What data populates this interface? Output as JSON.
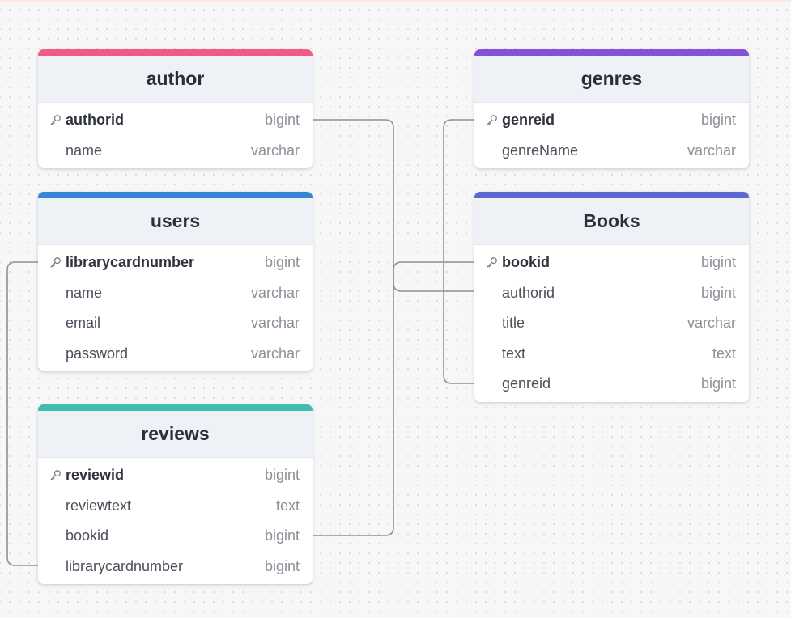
{
  "colors": {
    "author": "#ef5a86",
    "users": "#3584d6",
    "reviews": "#3dbfae",
    "genres": "#8452d6",
    "books": "#5a68cf",
    "link": "#8d9198"
  },
  "tables": {
    "author": {
      "title": "author",
      "columns": [
        {
          "name": "authorid",
          "type": "bigint",
          "pk": true
        },
        {
          "name": "name",
          "type": "varchar",
          "pk": false
        }
      ]
    },
    "users": {
      "title": "users",
      "columns": [
        {
          "name": "librarycardnumber",
          "type": "bigint",
          "pk": true
        },
        {
          "name": "name",
          "type": "varchar",
          "pk": false
        },
        {
          "name": "email",
          "type": "varchar",
          "pk": false
        },
        {
          "name": "password",
          "type": "varchar",
          "pk": false
        }
      ]
    },
    "reviews": {
      "title": "reviews",
      "columns": [
        {
          "name": "reviewid",
          "type": "bigint",
          "pk": true
        },
        {
          "name": "reviewtext",
          "type": "text",
          "pk": false
        },
        {
          "name": "bookid",
          "type": "bigint",
          "pk": false
        },
        {
          "name": "librarycardnumber",
          "type": "bigint",
          "pk": false
        }
      ]
    },
    "genres": {
      "title": "genres",
      "columns": [
        {
          "name": "genreid",
          "type": "bigint",
          "pk": true
        },
        {
          "name": "genreName",
          "type": "varchar",
          "pk": false
        }
      ]
    },
    "books": {
      "title": "Books",
      "columns": [
        {
          "name": "bookid",
          "type": "bigint",
          "pk": true
        },
        {
          "name": "authorid",
          "type": "bigint",
          "pk": false
        },
        {
          "name": "title",
          "type": "varchar",
          "pk": false
        },
        {
          "name": "text",
          "type": "text",
          "pk": false
        },
        {
          "name": "genreid",
          "type": "bigint",
          "pk": false
        }
      ]
    }
  },
  "relations": [
    {
      "from": "author.authorid",
      "to": "Books.authorid"
    },
    {
      "from": "genres.genreid",
      "to": "Books.genreid"
    },
    {
      "from": "Books.bookid",
      "to": "reviews.bookid"
    },
    {
      "from": "users.librarycardnumber",
      "to": "reviews.librarycardnumber"
    }
  ]
}
